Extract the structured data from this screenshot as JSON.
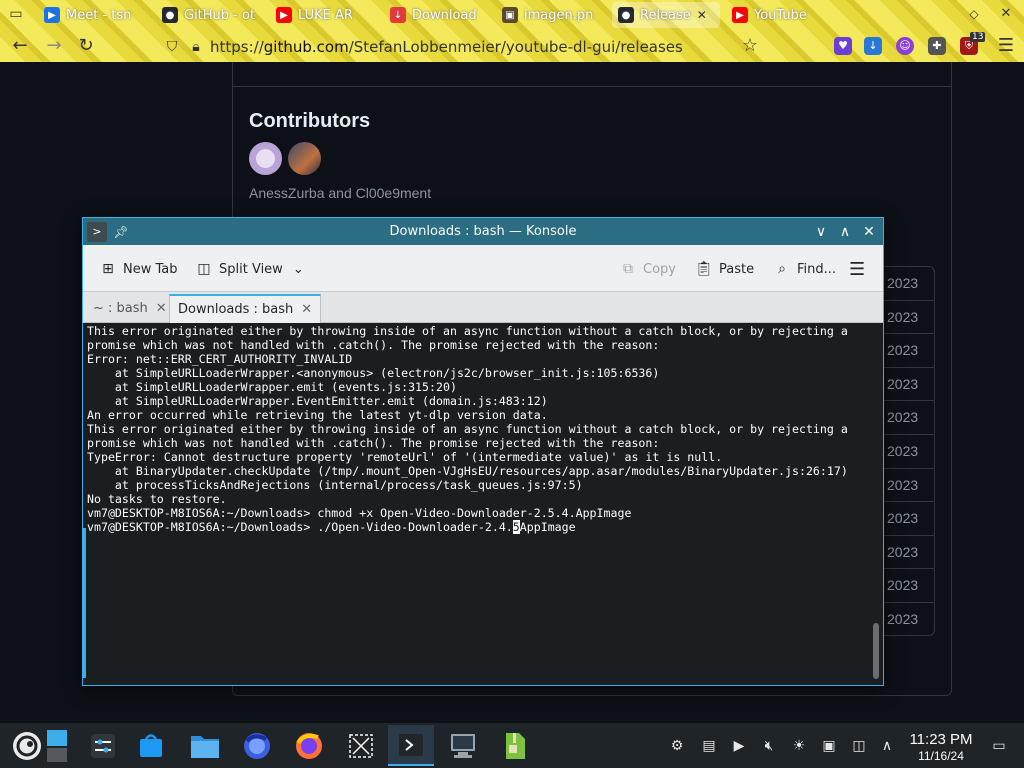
{
  "browser": {
    "tabs": [
      {
        "label": "Meet - tsn",
        "icon": "google-meet-icon",
        "color": "#1a73e8",
        "audio": true
      },
      {
        "label": "GitHub - ot",
        "icon": "github-icon",
        "color": "#24292f",
        "audio": true
      },
      {
        "label": "LUKE AR",
        "icon": "youtube-icon",
        "color": "#ff0000",
        "audio": true
      },
      {
        "label": "Download",
        "icon": "download-icon",
        "color": "#e33b3b"
      },
      {
        "label": "imagen.pn",
        "icon": "image-icon",
        "color": "#5a4a2a"
      },
      {
        "label": "Release",
        "icon": "github-icon",
        "color": "#24292f",
        "active": true
      },
      {
        "label": "YouTube",
        "icon": "youtube-icon",
        "color": "#ff0000"
      }
    ],
    "url": {
      "prefix": "https://",
      "host": "github.com",
      "path": "/StefanLobbenmeier/youtube-dl-gui/releases"
    },
    "extension_badge": "13"
  },
  "github": {
    "contributors_title": "Contributors",
    "contributors_names": "AnessZurba and Cl00e9ment",
    "asset_dates": [
      "2023",
      "2023",
      "2023",
      "2023",
      "2023",
      "2023",
      "2023",
      "2023",
      "2023",
      "2023",
      "2023"
    ]
  },
  "konsole": {
    "title": "Downloads : bash — Konsole",
    "toolbar": {
      "new_tab": "New Tab",
      "split_view": "Split View",
      "copy": "Copy",
      "paste": "Paste",
      "find": "Find..."
    },
    "tabs": [
      {
        "label": "~ : bash",
        "active": false
      },
      {
        "label": "Downloads : bash",
        "active": true
      }
    ],
    "terminal_lines": [
      "This error originated either by throwing inside of an async function without a catch block, or by rejecting a",
      "promise which was not handled with .catch(). The promise rejected with the reason:",
      "Error: net::ERR_CERT_AUTHORITY_INVALID",
      "    at SimpleURLLoaderWrapper.<anonymous> (electron/js2c/browser_init.js:105:6536)",
      "    at SimpleURLLoaderWrapper.emit (events.js:315:20)",
      "    at SimpleURLLoaderWrapper.EventEmitter.emit (domain.js:483:12)",
      "An error occurred while retrieving the latest yt-dlp version data.",
      "This error originated either by throwing inside of an async function without a catch block, or by rejecting a",
      "promise which was not handled with .catch(). The promise rejected with the reason:",
      "TypeError: Cannot destructure property 'remoteUrl' of '(intermediate value)' as it is null.",
      "    at BinaryUpdater.checkUpdate (/tmp/.mount_Open-VJgHsEU/resources/app.asar/modules/BinaryUpdater.js:26:17)",
      "    at processTicksAndRejections (internal/process/task_queues.js:97:5)",
      "No tasks to restore.",
      "vm7@DESKTOP-M8IOS6A:~/Downloads> chmod +x Open-Video-Downloader-2.5.4.AppImage"
    ],
    "prompt_line": {
      "before_cursor": "vm7@DESKTOP-M8IOS6A:~/Downloads> ./Open-Video-Downloader-2.4.",
      "cursor_char": "5",
      "after_cursor": "AppImage"
    }
  },
  "taskbar": {
    "clock_time": "11:23 PM",
    "clock_date": "11/16/24",
    "apps": [
      "opensuse-start-icon",
      "desktop-pager-icon",
      "system-settings-icon",
      "discover-store-icon",
      "dolphin-files-icon",
      "firefox-developer-icon",
      "firefox-icon",
      "spectacle-screenshot-icon",
      "konsole-icon",
      "virtual-machine-icon",
      "archive-manager-icon"
    ],
    "tray": [
      "kdeconnect-icon",
      "clipboard-icon",
      "media-player-icon",
      "volume-muted-icon",
      "brightness-icon",
      "disk-icon",
      "network-icon",
      "show-hidden-icon",
      "show-desktop-icon"
    ]
  }
}
